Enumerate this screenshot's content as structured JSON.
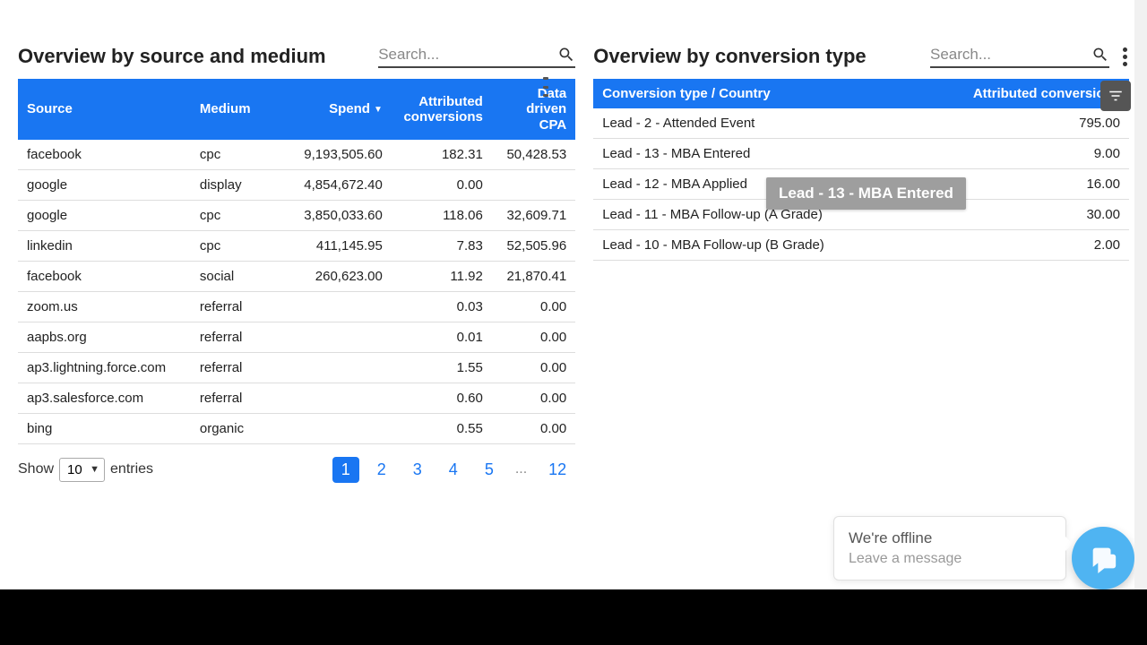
{
  "search_placeholder": "Search...",
  "left": {
    "title": "Overview by source and medium",
    "columns": {
      "source": "Source",
      "medium": "Medium",
      "spend": "Spend",
      "attributed_line1": "Attributed",
      "attributed_line2": "conversions",
      "cpa_line1": "Data",
      "cpa_line2": "driven",
      "cpa_line3": "CPA"
    },
    "rows": [
      {
        "source": "facebook",
        "medium": "cpc",
        "spend": "9,193,505.60",
        "conv": "182.31",
        "cpa": "50,428.53"
      },
      {
        "source": "google",
        "medium": "display",
        "spend": "4,854,672.40",
        "conv": "0.00",
        "cpa": ""
      },
      {
        "source": "google",
        "medium": "cpc",
        "spend": "3,850,033.60",
        "conv": "118.06",
        "cpa": "32,609.71"
      },
      {
        "source": "linkedin",
        "medium": "cpc",
        "spend": "411,145.95",
        "conv": "7.83",
        "cpa": "52,505.96"
      },
      {
        "source": "facebook",
        "medium": "social",
        "spend": "260,623.00",
        "conv": "11.92",
        "cpa": "21,870.41"
      },
      {
        "source": "zoom.us",
        "medium": "referral",
        "spend": "",
        "conv": "0.03",
        "cpa": "0.00"
      },
      {
        "source": "aapbs.org",
        "medium": "referral",
        "spend": "",
        "conv": "0.01",
        "cpa": "0.00"
      },
      {
        "source": "ap3.lightning.force.com",
        "medium": "referral",
        "spend": "",
        "conv": "1.55",
        "cpa": "0.00"
      },
      {
        "source": "ap3.salesforce.com",
        "medium": "referral",
        "spend": "",
        "conv": "0.60",
        "cpa": "0.00"
      },
      {
        "source": "bing",
        "medium": "organic",
        "spend": "",
        "conv": "0.55",
        "cpa": "0.00"
      }
    ],
    "show_label_pre": "Show",
    "show_value": "10",
    "show_label_post": "entries",
    "pages": [
      "1",
      "2",
      "3",
      "4",
      "5",
      "...",
      "12"
    ],
    "active_page": "1"
  },
  "right": {
    "title": "Overview by conversion type",
    "columns": {
      "type": "Conversion type / Country",
      "conv": "Attributed conversions"
    },
    "rows": [
      {
        "type": "Lead - 2 - Attended Event",
        "conv": "795.00"
      },
      {
        "type": "Lead - 13 - MBA Entered",
        "conv": "9.00"
      },
      {
        "type": "Lead - 12 - MBA Applied",
        "conv": "16.00"
      },
      {
        "type": "Lead - 11 - MBA Follow-up (A Grade)",
        "conv": "30.00"
      },
      {
        "type": "Lead - 10 - MBA Follow-up (B Grade)",
        "conv": "2.00"
      }
    ]
  },
  "tooltip": "Lead - 13 - MBA Entered",
  "chat": {
    "title": "We're offline",
    "sub": "Leave a message"
  }
}
